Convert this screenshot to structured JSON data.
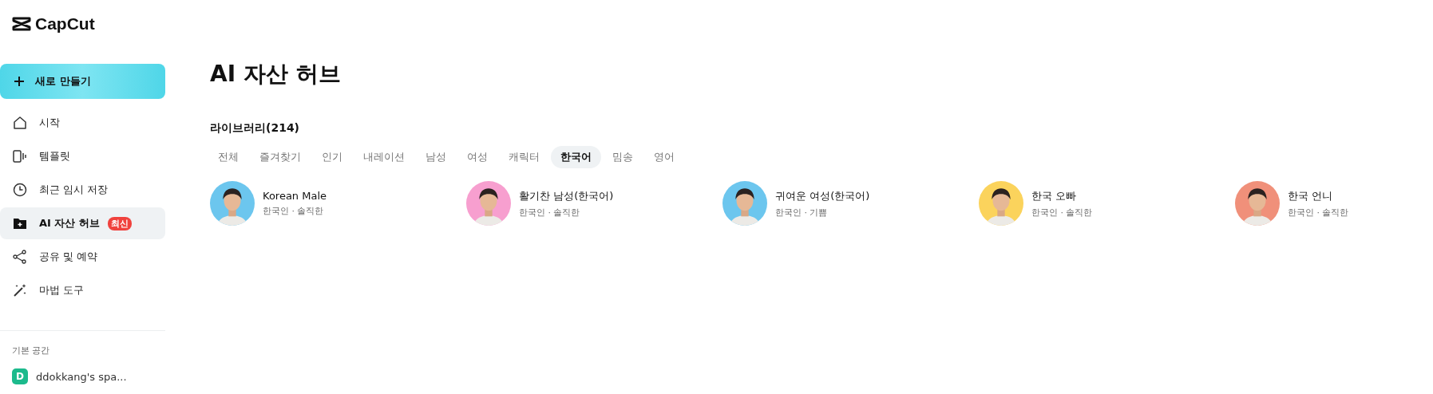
{
  "logo": {
    "text": "CapCut"
  },
  "create_button": {
    "label": "새로 만들기"
  },
  "nav": [
    {
      "label": "시작",
      "selected": false
    },
    {
      "label": "템플릿",
      "selected": false
    },
    {
      "label": "최근 임시 저장",
      "selected": false
    },
    {
      "label": "AI 자산 허브",
      "selected": true,
      "badge": "최신"
    },
    {
      "label": "공유 및 예약",
      "selected": false
    },
    {
      "label": "마법 도구",
      "selected": false
    }
  ],
  "workspace": {
    "heading": "기본 공간",
    "initial": "D",
    "name": "ddokkang's spa..."
  },
  "page_title": "AI 자산 허브",
  "library": {
    "heading": "라이브러리(214)"
  },
  "filters": [
    {
      "label": "전체",
      "selected": false
    },
    {
      "label": "즐겨찾기",
      "selected": false
    },
    {
      "label": "인기",
      "selected": false
    },
    {
      "label": "내레이션",
      "selected": false
    },
    {
      "label": "남성",
      "selected": false
    },
    {
      "label": "여성",
      "selected": false
    },
    {
      "label": "캐릭터",
      "selected": false
    },
    {
      "label": "한국어",
      "selected": true
    },
    {
      "label": "밈송",
      "selected": false
    },
    {
      "label": "영어",
      "selected": false
    }
  ],
  "voices": [
    {
      "name": "Korean Male",
      "tags": "한국인 · 솔직한",
      "color": "#6cc6ee"
    },
    {
      "name": "활기찬 남성(한국어)",
      "tags": "한국인 · 솔직한",
      "color": "#f79fcf"
    },
    {
      "name": "귀여운 여성(한국어)",
      "tags": "한국인 · 기쁨",
      "color": "#6cc6ee"
    },
    {
      "name": "한국 오빠",
      "tags": "한국인 · 솔직한",
      "color": "#fbd35c"
    },
    {
      "name": "한국 언니",
      "tags": "한국인 · 솔직한",
      "color": "#f0907a"
    }
  ]
}
